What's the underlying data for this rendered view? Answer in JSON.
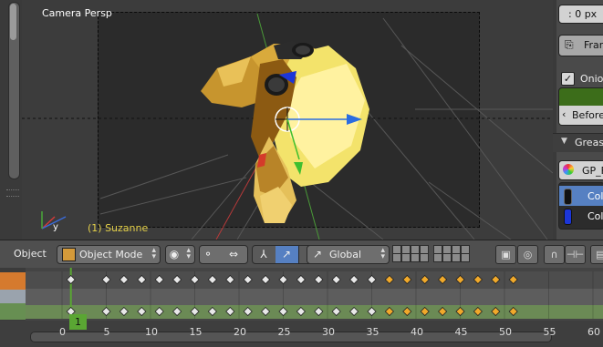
{
  "viewport": {
    "camera_label": "Camera Persp",
    "object_label": "(1) Suzanne",
    "axis_y_label": "y"
  },
  "properties": {
    "offset_value": ": 0 px",
    "frame_button": "Fram",
    "onion_checked": true,
    "onion_label": "Onion",
    "before_label": "Before",
    "grease_header": "Greas",
    "gp_field": "GP_F",
    "colors": [
      {
        "label": "Col",
        "swatch": "#111111"
      },
      {
        "label": "Col",
        "swatch": "#1c36d8"
      }
    ]
  },
  "header": {
    "object_menu": "Object",
    "mode": "Object Mode",
    "orientation": "Global"
  },
  "dopesheet": {
    "current_frame": "1",
    "ruler": [
      "0",
      "5",
      "10",
      "15",
      "20",
      "25",
      "30",
      "35",
      "40",
      "45",
      "50",
      "55",
      "60"
    ],
    "keyframes_white": [
      1,
      5,
      7,
      9,
      11,
      13,
      15,
      17,
      19,
      21,
      23,
      25,
      27,
      29,
      31,
      33,
      35
    ],
    "keyframes_orange": [
      37,
      39,
      41,
      43,
      45,
      47,
      49,
      51
    ]
  },
  "colors": {
    "accent_blue": "#5680c2",
    "keyframe_white": "#e8e8e8",
    "keyframe_orange": "#f0a92b",
    "current_frame_green": "#5aa633"
  }
}
